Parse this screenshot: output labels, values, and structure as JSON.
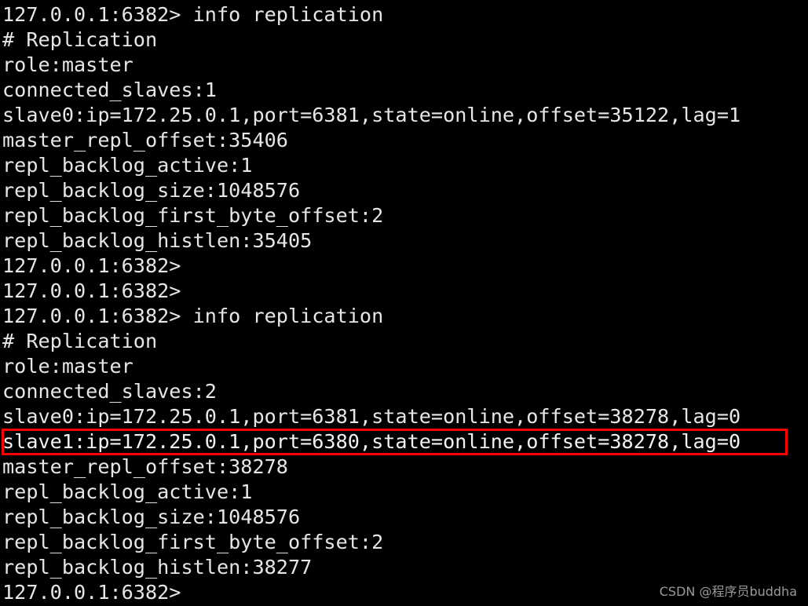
{
  "terminal": {
    "background_color": "#000000",
    "text_color": "#e6e6e6",
    "highlight_color": "#ff0000",
    "lines": [
      {
        "text": "127.0.0.1:6382> info replication",
        "kind": "prompt-command",
        "highlighted": false
      },
      {
        "text": "# Replication",
        "kind": "section-header",
        "highlighted": false
      },
      {
        "text": "role:master",
        "kind": "field",
        "highlighted": false
      },
      {
        "text": "connected_slaves:1",
        "kind": "field",
        "highlighted": false
      },
      {
        "text": "slave0:ip=172.25.0.1,port=6381,state=online,offset=35122,lag=1",
        "kind": "field",
        "highlighted": false
      },
      {
        "text": "master_repl_offset:35406",
        "kind": "field",
        "highlighted": false
      },
      {
        "text": "repl_backlog_active:1",
        "kind": "field",
        "highlighted": false
      },
      {
        "text": "repl_backlog_size:1048576",
        "kind": "field",
        "highlighted": false
      },
      {
        "text": "repl_backlog_first_byte_offset:2",
        "kind": "field",
        "highlighted": false
      },
      {
        "text": "repl_backlog_histlen:35405",
        "kind": "field",
        "highlighted": false
      },
      {
        "text": "127.0.0.1:6382>",
        "kind": "prompt",
        "highlighted": false
      },
      {
        "text": "127.0.0.1:6382>",
        "kind": "prompt",
        "highlighted": false
      },
      {
        "text": "127.0.0.1:6382> info replication",
        "kind": "prompt-command",
        "highlighted": false
      },
      {
        "text": "# Replication",
        "kind": "section-header",
        "highlighted": false
      },
      {
        "text": "role:master",
        "kind": "field",
        "highlighted": false
      },
      {
        "text": "connected_slaves:2",
        "kind": "field",
        "highlighted": false
      },
      {
        "text": "slave0:ip=172.25.0.1,port=6381,state=online,offset=38278,lag=0",
        "kind": "field",
        "highlighted": false
      },
      {
        "text": "slave1:ip=172.25.0.1,port=6380,state=online,offset=38278,lag=0",
        "kind": "field",
        "highlighted": true
      },
      {
        "text": "master_repl_offset:38278",
        "kind": "field",
        "highlighted": false
      },
      {
        "text": "repl_backlog_active:1",
        "kind": "field",
        "highlighted": false
      },
      {
        "text": "repl_backlog_size:1048576",
        "kind": "field",
        "highlighted": false
      },
      {
        "text": "repl_backlog_first_byte_offset:2",
        "kind": "field",
        "highlighted": false
      },
      {
        "text": "repl_backlog_histlen:38277",
        "kind": "field",
        "highlighted": false
      },
      {
        "text": "127.0.0.1:6382>",
        "kind": "prompt",
        "highlighted": false
      }
    ]
  },
  "watermark": {
    "text": "CSDN @程序员buddha"
  }
}
